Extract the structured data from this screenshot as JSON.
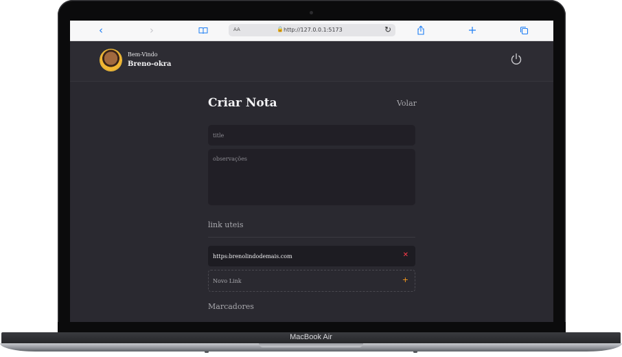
{
  "device": {
    "label": "MacBook Air"
  },
  "browser": {
    "text_size_label": "AA",
    "url": "http://127.0.0.1:5173",
    "icons": [
      "back-icon",
      "forward-icon",
      "book-icon",
      "lock-icon",
      "reload-icon",
      "share-icon",
      "new-tab-icon",
      "tabs-icon"
    ]
  },
  "header": {
    "welcome_label": "Bem-Vindo",
    "username": "Breno-okra",
    "logout_icon": "power-icon"
  },
  "form": {
    "title": "Criar Nota",
    "back_label": "Volar",
    "title_placeholder": "title",
    "notes_placeholder": "observações"
  },
  "links_section": {
    "heading": "link uteis",
    "items": [
      {
        "url": "https:brenolindodemais.com",
        "remove_icon": "close-icon"
      }
    ],
    "new_link_placeholder": "Novo Link",
    "add_icon": "plus-icon"
  },
  "tags_section": {
    "heading": "Marcadores"
  },
  "colors": {
    "background": "#2a2930",
    "header_bg": "#2d2c33",
    "field_bg": "#211f26",
    "remove_accent": "#ff3b4a",
    "add_accent": "#ff9f1c",
    "safari_blue": "#1a7cf5"
  }
}
